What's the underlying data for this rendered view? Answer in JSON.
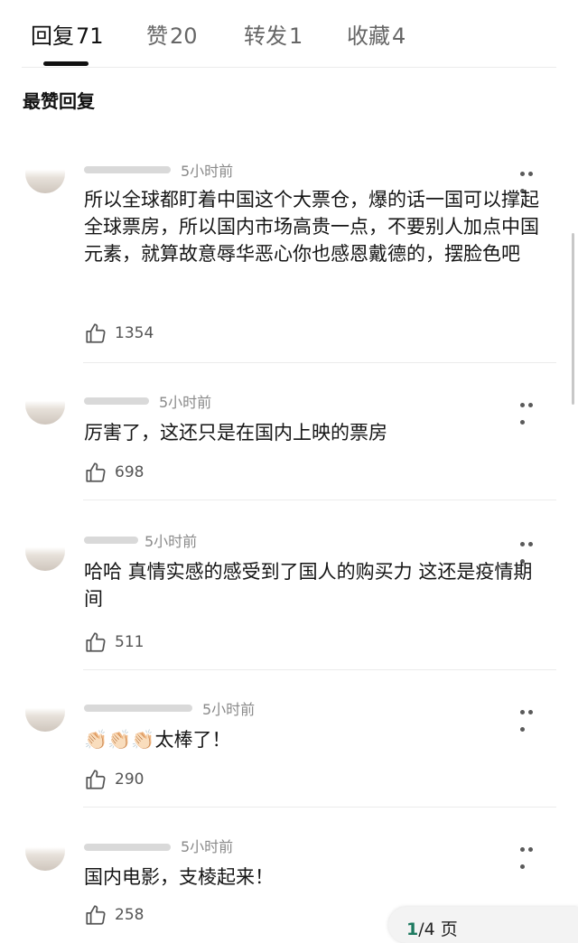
{
  "tabs": [
    {
      "label": "回复",
      "count": "71"
    },
    {
      "label": "赞",
      "count": "20"
    },
    {
      "label": "转发",
      "count": "1"
    },
    {
      "label": "收藏",
      "count": "4"
    }
  ],
  "section_title": "最赞回复",
  "comments": [
    {
      "time": "5小时前",
      "text": "所以全球都盯着中国这个大票仓，爆的话一国可以撑起全球票房，所以国内市场高贵一点，不要别人加点中国元素，就算故意辱华恶心你也感恩戴德的，摆脸色吧",
      "likes": "1354"
    },
    {
      "time": "5小时前",
      "text": "厉害了，这还只是在国内上映的票房",
      "likes": "698"
    },
    {
      "time": "5小时前",
      "text": "哈哈 真情实感的感受到了国人的购买力 这还是疫情期间",
      "likes": "511"
    },
    {
      "time": "5小时前",
      "text": "👏🏻👏🏻👏🏻太棒了！",
      "likes": "290"
    },
    {
      "time": "5小时前",
      "text": "国内电影，支棱起来！",
      "likes": "258"
    }
  ],
  "pager": {
    "current": "1",
    "total_text": "/4 页"
  },
  "icons": {
    "like": "thumbs-up-icon",
    "more": "more-dots-icon"
  }
}
